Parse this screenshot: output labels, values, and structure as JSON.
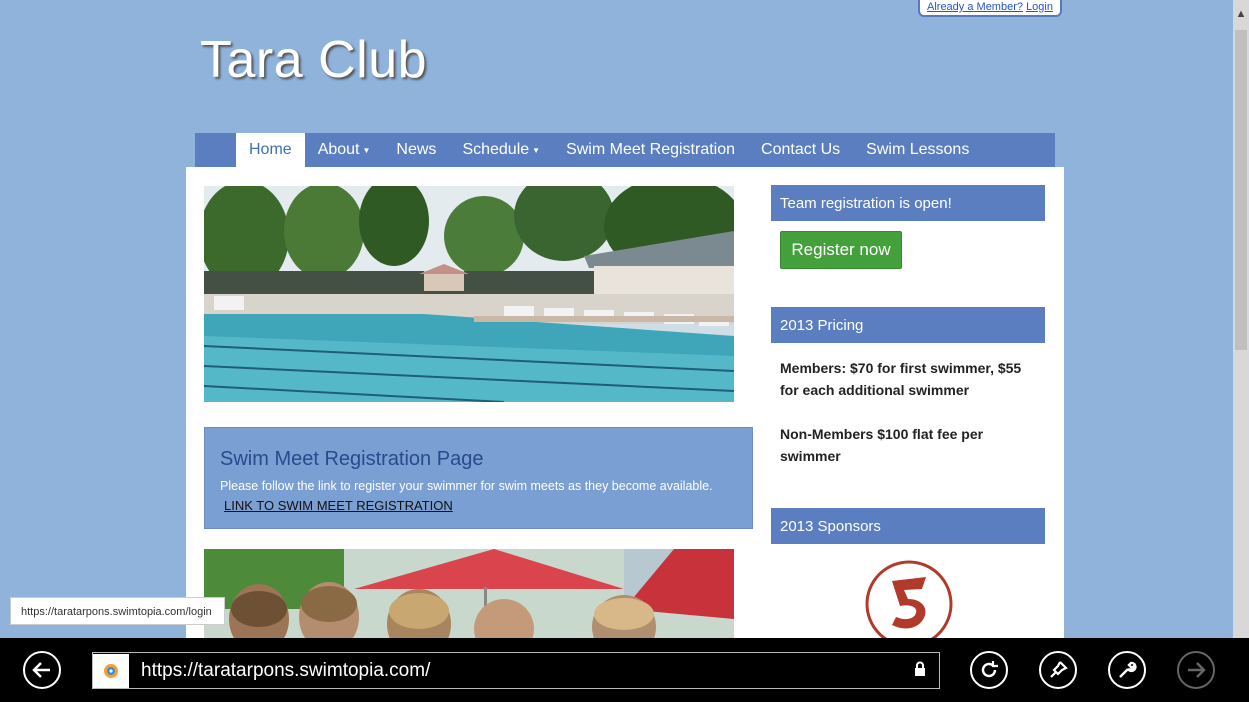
{
  "login_tab": {
    "prefix": "Already a Member?",
    "link": "Login"
  },
  "site_title": "Tara Club",
  "nav": {
    "items": [
      {
        "label": "Home",
        "active": true
      },
      {
        "label": "About",
        "dropdown": true
      },
      {
        "label": "News"
      },
      {
        "label": "Schedule",
        "dropdown": true
      },
      {
        "label": "Swim Meet Registration"
      },
      {
        "label": "Contact Us"
      },
      {
        "label": "Swim Lessons"
      }
    ]
  },
  "notice": {
    "title": "Swim Meet Registration Page",
    "text": "Please follow the link to register your swimmer for swim meets as they become available.",
    "link": "LINK TO SWIM MEET REGISTRATION"
  },
  "sidebar": {
    "registration_header": "Team registration is open!",
    "register_button": "Register now",
    "pricing_header": "2013 Pricing",
    "pricing_members": "Members: $70 for first swimmer, $55 for each additional swimmer",
    "pricing_nonmembers": "Non-Members $100 flat fee per swimmer",
    "sponsors_header": "2013 Sponsors"
  },
  "status_url": "https://taratarpons.swimtopia.com/login",
  "browser": {
    "url": "https://taratarpons.swimtopia.com/"
  },
  "colors": {
    "page_bg": "#8fb3db",
    "nav_bg": "#5b7ec0",
    "button_green": "#44a03a",
    "notice_bg": "#7a9fd3"
  }
}
